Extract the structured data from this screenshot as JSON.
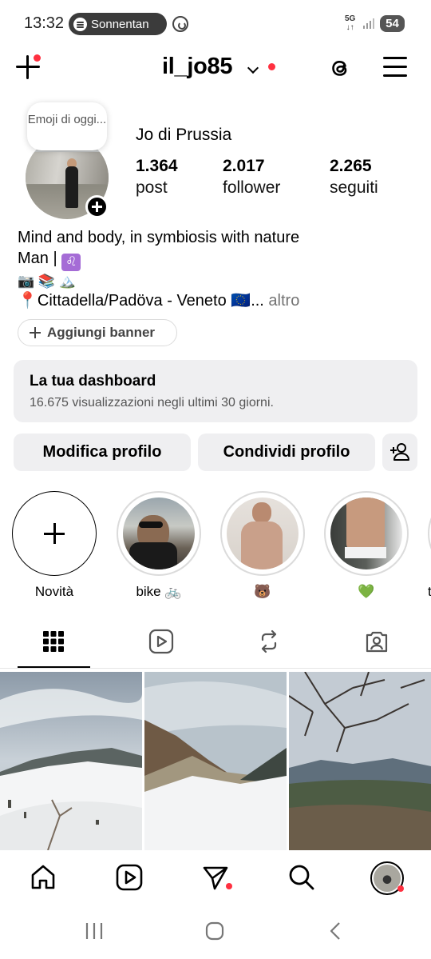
{
  "status_bar": {
    "time": "13:32",
    "media_pill_text": "Sonnentan",
    "network": "5G",
    "battery": "54"
  },
  "header": {
    "username": "il_jo85",
    "icons": [
      "plus-icon",
      "chevron-down-icon",
      "threads-icon",
      "menu-icon"
    ]
  },
  "profile": {
    "note": "Emoji di oggi...",
    "full_name": "Jo di Prussia",
    "stats": [
      {
        "value": "1.364",
        "label": "post"
      },
      {
        "value": "2.017",
        "label": "follower"
      },
      {
        "value": "2.265",
        "label": "seguiti"
      }
    ],
    "bio": {
      "line1": "Mind and body, in symbiosis with nature",
      "line2": "Man |",
      "line2_symbol": "♌",
      "line3": "📷 📚 🏔️",
      "line4": "📍Cittadella/Padöva -  Veneto  🇪🇺...",
      "more": " altro"
    },
    "add_banner_label": "Aggiungi banner"
  },
  "dashboard": {
    "title": "La tua dashboard",
    "subtitle": "16.675 visualizzazioni negli ultimi 30 giorni."
  },
  "actions": {
    "edit_profile": "Modifica profilo",
    "share_profile": "Condividi profilo"
  },
  "highlights": [
    {
      "label": "Novità"
    },
    {
      "label": "bike 🚲"
    },
    {
      "label": "🐻"
    },
    {
      "label": "💚"
    },
    {
      "label": "t"
    }
  ],
  "tabs": [
    "grid-icon",
    "reels-icon",
    "reposts-icon",
    "tagged-icon"
  ],
  "colors": {
    "notification_dot": "#ff3040",
    "button_bg": "#efeff1",
    "secondary_text": "#737373"
  }
}
